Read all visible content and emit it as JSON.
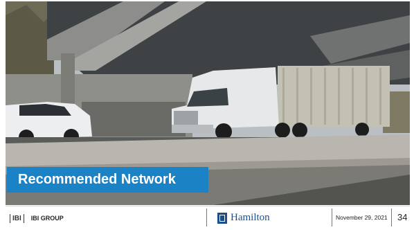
{
  "slide": {
    "title": "Recommended Network",
    "photo_description": "",
    "colors": {
      "title_banner": "#1b82c6",
      "hamilton_blue": "#1a4f8b"
    }
  },
  "footer": {
    "company_mark": "IBI",
    "company_name": "IBI GROUP",
    "client_name": "Hamilton",
    "client_emblem_icon": "hamilton-crest-icon",
    "date": "November 29, 2021",
    "page_number": "34"
  }
}
